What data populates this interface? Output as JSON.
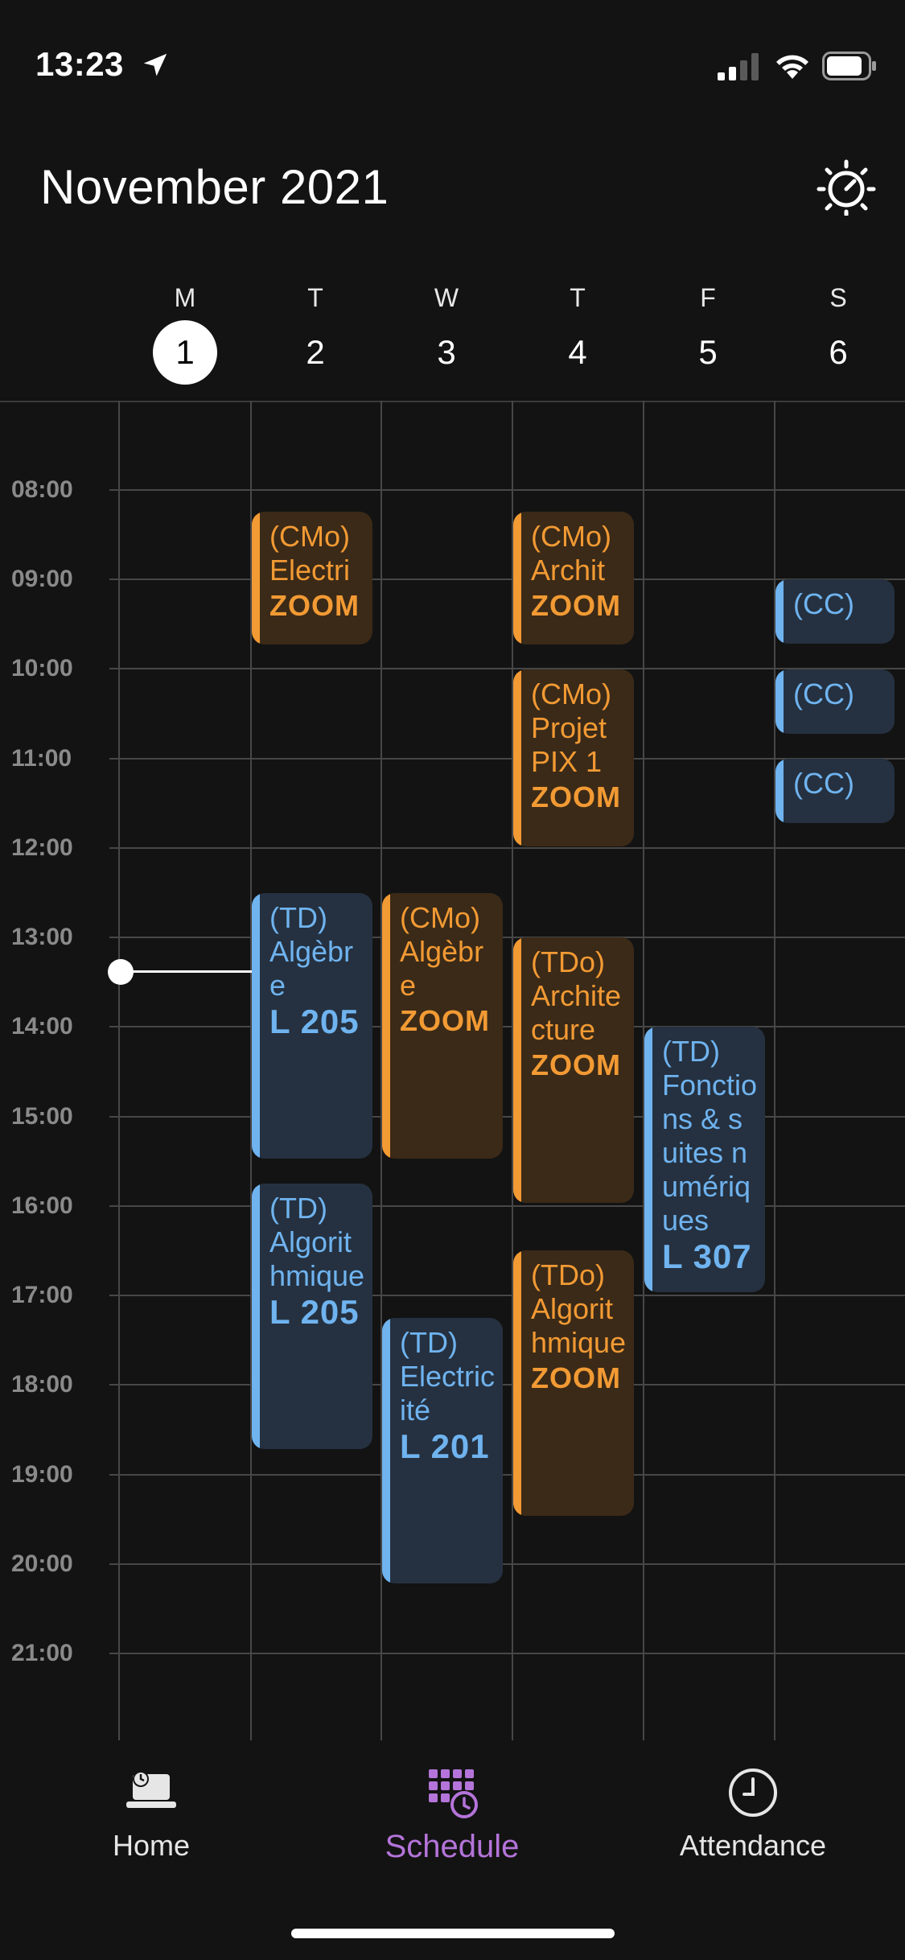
{
  "status_bar": {
    "time": "13:23"
  },
  "header": {
    "month": "November 2021"
  },
  "days": [
    {
      "letter": "M",
      "number": "1",
      "today": true
    },
    {
      "letter": "T",
      "number": "2"
    },
    {
      "letter": "W",
      "number": "3"
    },
    {
      "letter": "T",
      "number": "4"
    },
    {
      "letter": "F",
      "number": "5"
    },
    {
      "letter": "S",
      "number": "6"
    }
  ],
  "time_labels": [
    "08:00",
    "09:00",
    "10:00",
    "11:00",
    "12:00",
    "13:00",
    "14:00",
    "15:00",
    "16:00",
    "17:00",
    "18:00",
    "19:00",
    "20:00",
    "21:00"
  ],
  "events": {
    "tue_cmo_electri": {
      "type": "(CMo)",
      "name": "Electri",
      "room": "ZOOM"
    },
    "thu_cmo_archit": {
      "type": "(CMo)",
      "name": "Archit",
      "room": "ZOOM"
    },
    "sat_cc_1": {
      "type": "(CC)"
    },
    "thu_cmo_projet": {
      "type": "(CMo)",
      "name": "Projet PIX 1",
      "room": "ZOOM"
    },
    "sat_cc_2": {
      "type": "(CC)"
    },
    "sat_cc_3": {
      "type": "(CC)"
    },
    "tue_td_algebre": {
      "type": "(TD)",
      "name": "Algèbre",
      "room": "L 205"
    },
    "wed_cmo_algebre": {
      "type": "(CMo)",
      "name": "Algèbre",
      "room": "ZOOM"
    },
    "thu_tdo_architecture": {
      "type": "(TDo)",
      "name": "Architecture",
      "room": "ZOOM"
    },
    "fri_td_fonctions": {
      "type": "(TD)",
      "name": "Fonctions & suites numériques",
      "room": "L 307"
    },
    "tue_td_algorithmique": {
      "type": "(TD)",
      "name": "Algorithmique",
      "room": "L 205"
    },
    "thu_tdo_algorithmique": {
      "type": "(TDo)",
      "name": "Algorithmique",
      "room": "ZOOM"
    },
    "wed_td_electricite": {
      "type": "(TD)",
      "name": "Electricité",
      "room": "L 201"
    }
  },
  "nav": {
    "home": "Home",
    "schedule": "Schedule",
    "attendance": "Attendance"
  },
  "colors": {
    "cm_accent": "#f29a34",
    "td_accent": "#6fb3ef",
    "active_tab": "#b474d9"
  },
  "icons": [
    "location-arrow-icon",
    "signal-icon",
    "wifi-icon",
    "battery-icon",
    "settings-icon",
    "home-laptop-icon",
    "schedule-calendar-icon",
    "attendance-clock-icon"
  ]
}
